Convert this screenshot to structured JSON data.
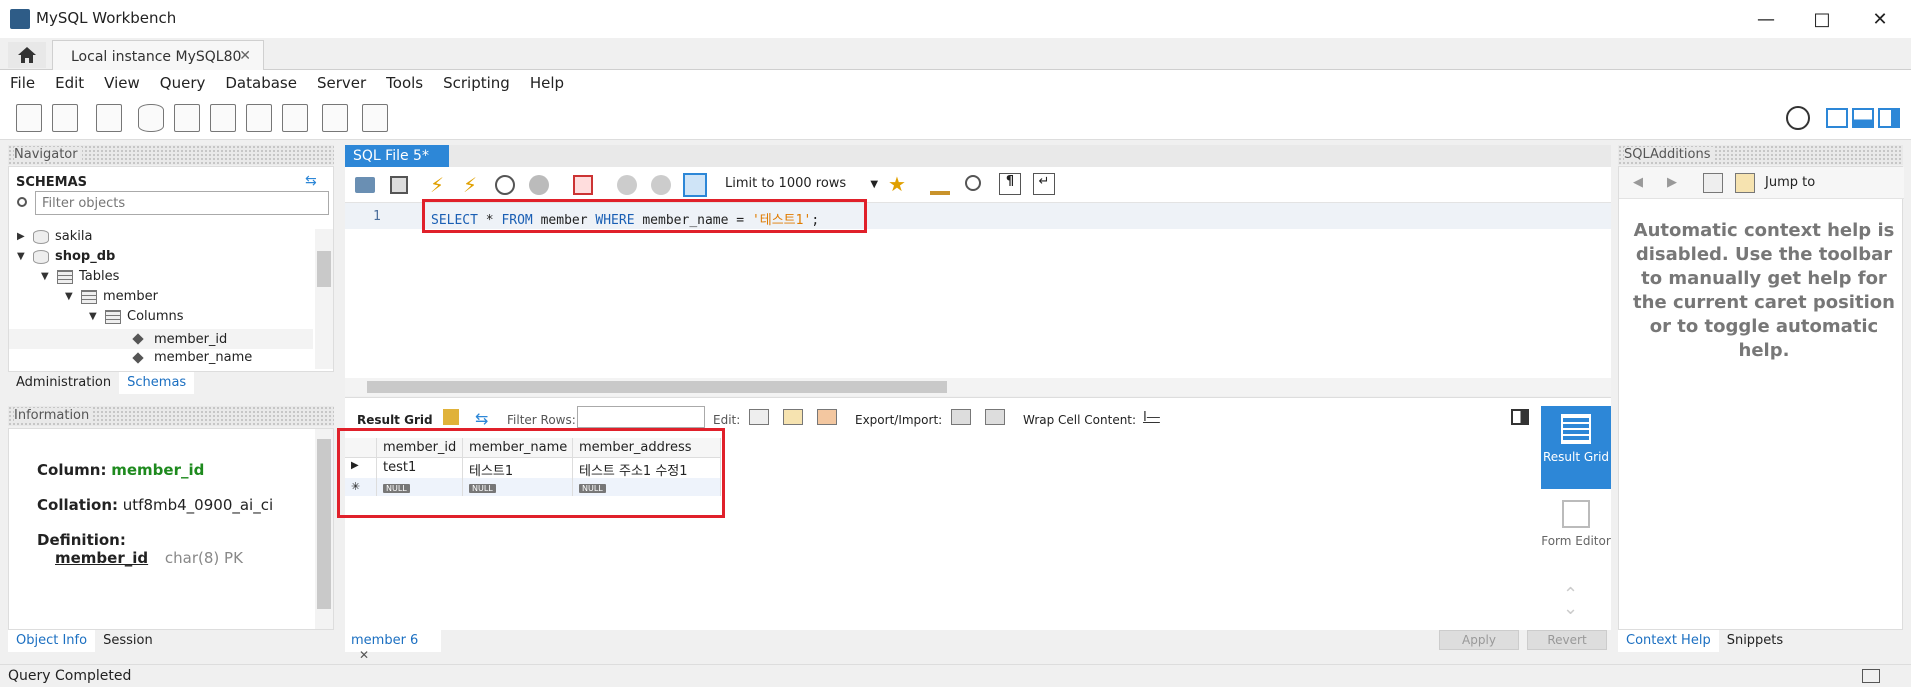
{
  "app_title": "MySQL Workbench",
  "connection_tab": "Local instance MySQL80",
  "menu": [
    "File",
    "Edit",
    "View",
    "Query",
    "Database",
    "Server",
    "Tools",
    "Scripting",
    "Help"
  ],
  "navigator": {
    "header": "Navigator",
    "schemas_label": "SCHEMAS",
    "filter_placeholder": "Filter objects",
    "tree": [
      {
        "label": "sakila",
        "level": 0,
        "expanded": false,
        "kind": "db"
      },
      {
        "label": "shop_db",
        "level": 0,
        "expanded": true,
        "kind": "db",
        "bold": true
      },
      {
        "label": "Tables",
        "level": 1,
        "expanded": true,
        "kind": "folder"
      },
      {
        "label": "member",
        "level": 2,
        "expanded": true,
        "kind": "table"
      },
      {
        "label": "Columns",
        "level": 3,
        "expanded": true,
        "kind": "folder"
      },
      {
        "label": "member_id",
        "level": 4,
        "kind": "column",
        "selected": true
      },
      {
        "label": "member_name",
        "level": 4,
        "kind": "column"
      }
    ],
    "tabs": [
      "Administration",
      "Schemas"
    ],
    "active_tab": "Schemas"
  },
  "information": {
    "header": "Information",
    "column_label": "Column:",
    "column_value": "member_id",
    "collation_label": "Collation:",
    "collation_value": "utf8mb4_0900_ai_ci",
    "definition_label": "Definition:",
    "def_name": "member_id",
    "def_type": "char(8) PK",
    "tabs": [
      "Object Info",
      "Session"
    ]
  },
  "editor": {
    "tab_label": "SQL File 5*",
    "limit_label": "Limit to 1000 rows",
    "line_number": "1",
    "sql_kw1": "SELECT",
    "sql_star": "*",
    "sql_kw2": "FROM",
    "sql_table": "member",
    "sql_kw3": "WHERE",
    "sql_col": "member_name",
    "sql_eq": "=",
    "sql_str": "'테스트1'",
    "sql_end": ";"
  },
  "result": {
    "result_grid_label": "Result Grid",
    "filter_rows_label": "Filter Rows:",
    "edit_label": "Edit:",
    "export_label": "Export/Import:",
    "wrap_label": "Wrap Cell Content:",
    "columns": [
      "member_id",
      "member_name",
      "member_address"
    ],
    "rows": [
      [
        "test1",
        "테스트1",
        "테스트 주소1 수정1"
      ]
    ],
    "null_label": "NULL",
    "tab_label": "member 6",
    "apply_label": "Apply",
    "revert_label": "Revert",
    "side_result_grid": "Result Grid",
    "side_form_editor": "Form Editor"
  },
  "sql_additions": {
    "header": "SQLAdditions",
    "jump_to": "Jump to",
    "help_text": "Automatic context help is disabled. Use the toolbar to manually get help for the current caret position or to toggle automatic help.",
    "tabs": [
      "Context Help",
      "Snippets"
    ]
  },
  "status": "Query Completed",
  "colors": {
    "accent": "#2d87d7",
    "highlight": "#e0202a",
    "keyword": "#1a5fb4",
    "string": "#e07b00",
    "green": "#1e8a1e"
  }
}
